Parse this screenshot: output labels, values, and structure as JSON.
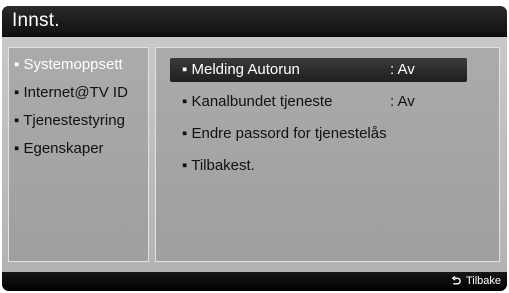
{
  "title": "Innst.",
  "left_menu": {
    "items": [
      {
        "label": "▪ Systemoppsett",
        "state": "active"
      },
      {
        "label": "▪ Internet@TV ID",
        "state": "inactive"
      },
      {
        "label": "▪ Tjenestestyring",
        "state": "inactive"
      },
      {
        "label": "▪ Egenskaper",
        "state": "inactive"
      }
    ]
  },
  "right_menu": {
    "items": [
      {
        "label": "▪ Melding Autorun",
        "value": ": Av",
        "selected": true
      },
      {
        "label": "▪ Kanalbundet tjeneste",
        "value": ": Av",
        "selected": false
      },
      {
        "label": "▪ Endre passord for tjenestelås",
        "value": "",
        "selected": false
      },
      {
        "label": "▪ Tilbakest.",
        "value": "",
        "selected": false
      }
    ]
  },
  "footer": {
    "back_label": "Tilbake",
    "back_icon": "return-arrow-icon"
  },
  "colors": {
    "title_bar": "#1a1a1a",
    "panel": "#a6a6a6",
    "body": "#bfbfbf",
    "selected_row": "#2d2d2d",
    "active_text": "#ffffff",
    "text": "#111111"
  }
}
